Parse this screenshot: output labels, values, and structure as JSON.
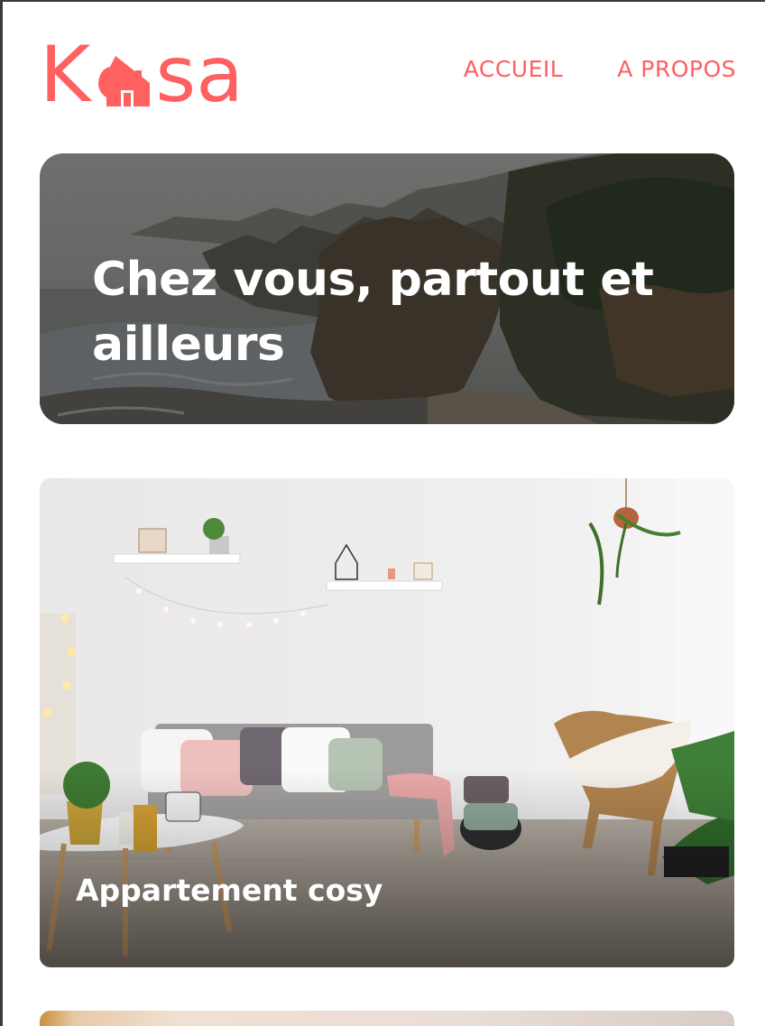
{
  "header": {
    "logo": {
      "text_start": "K",
      "text_end": "sa",
      "icon": "house-icon",
      "brand_color": "#FF6060"
    },
    "nav": [
      {
        "label": "ACCUEIL"
      },
      {
        "label": "A PROPOS"
      }
    ]
  },
  "banner": {
    "title": "Chez vous, partout et ailleurs"
  },
  "listings": [
    {
      "title": "Appartement cosy"
    },
    {
      "title": ""
    }
  ]
}
